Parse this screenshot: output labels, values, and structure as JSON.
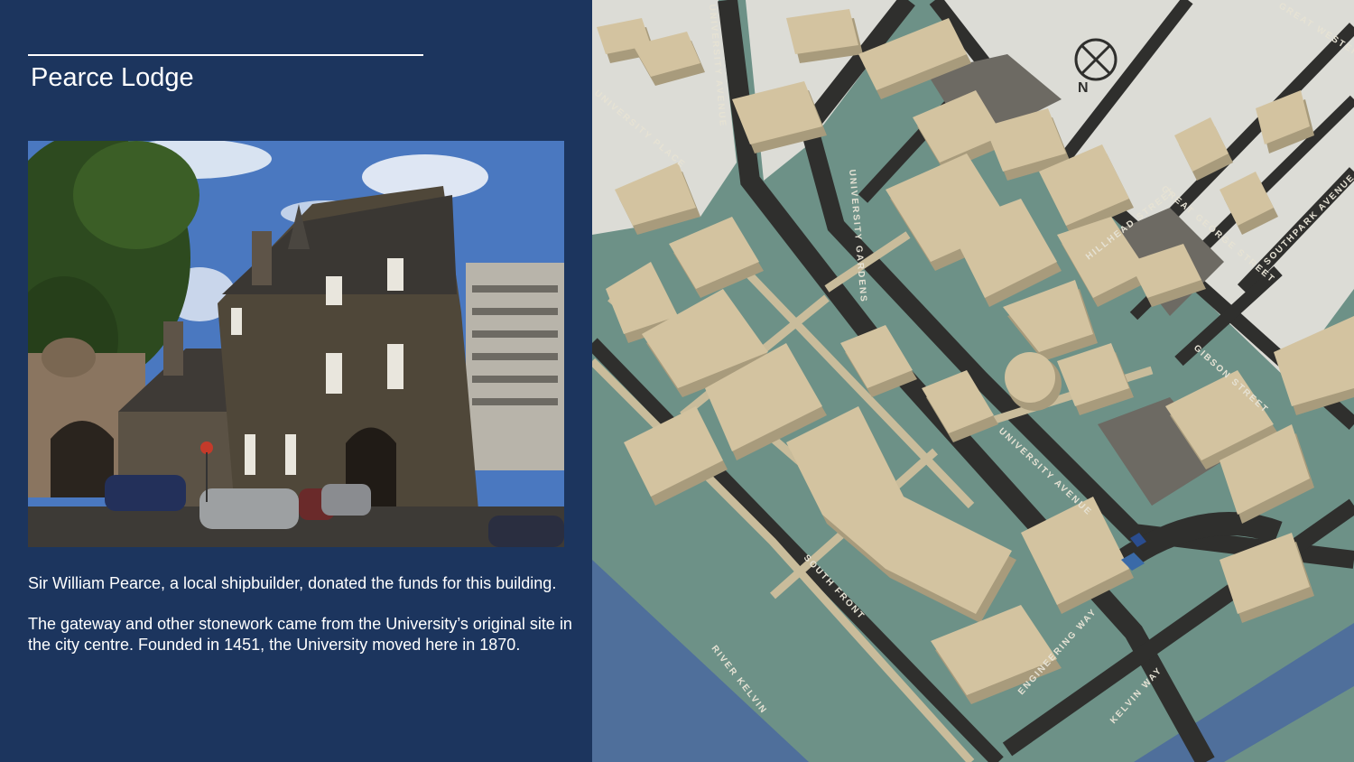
{
  "slide": {
    "title": "Pearce Lodge",
    "paragraph1": "Sir William Pearce, a local shipbuilder, donated the funds for this building.",
    "paragraph2": "The gateway and other stonework came from the University’s original site in the city centre.  Founded in 1451, the University moved here in 1870."
  },
  "map": {
    "compass_label": "N",
    "street_labels": {
      "great_western": "GREAT WESTERN",
      "university_avenue_top": "UNIVERSITY AVENUE",
      "university_place": "UNIVERSITY PLACE",
      "university_gardens": "UNIVERSITY GARDENS",
      "hillhead_street": "HILLHEAD STREET",
      "great_george_street": "GREAT GEORGE STREET",
      "southpark_avenue": "SOUTHPARK AVENUE",
      "gibson_street": "GIBSON STREET",
      "university_avenue_mid": "UNIVERSITY AVENUE",
      "south_front": "SOUTH FRONT",
      "engineering_way": "ENGINEERING WAY",
      "river_kelvin": "RIVER KELVIN",
      "kelvin_way": "KELVIN WAY"
    },
    "colors": {
      "park": "#6d9187",
      "road": "#2f2f2d",
      "path": "#c9bc9b",
      "building": "#d3c3a0",
      "river": "#4f6f9b",
      "marker": "#2a4d8f"
    }
  },
  "photo": {
    "icon": "building-photo"
  }
}
